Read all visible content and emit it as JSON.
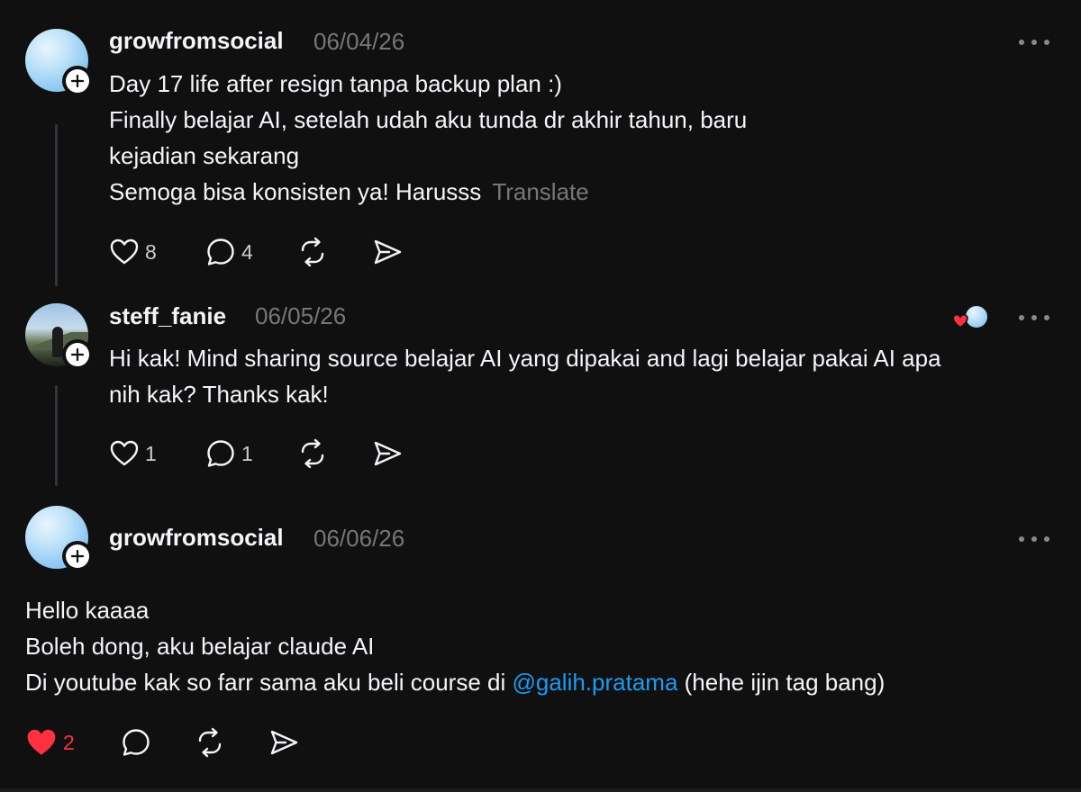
{
  "posts": [
    {
      "username": "growfromsocial",
      "date": "06/04/26",
      "lines": [
        "Day 17 life after resign tanpa backup plan :)",
        "Finally belajar AI, setelah udah aku tunda dr akhir tahun, baru",
        "kejadian sekarang",
        "Semoga bisa konsisten ya! Harusss"
      ],
      "translate_label": "Translate",
      "likes": "8",
      "replies": "4"
    },
    {
      "username": "steff_fanie",
      "date": "06/05/26",
      "lines": [
        "Hi kak! Mind sharing source belajar AI yang dipakai and lagi belajar pakai AI apa",
        "nih kak? Thanks kak!"
      ],
      "likes": "1",
      "replies": "1"
    },
    {
      "username": "growfromsocial",
      "date": "06/06/26",
      "lines": [
        "Hello kaaaa",
        "Boleh dong, aku belajar claude AI"
      ],
      "line3_before": "Di youtube kak so farr sama aku beli course di ",
      "mention": "@galih.pratama",
      "line3_after": " (hehe ijin tag bang)",
      "likes": "2",
      "liked": true
    }
  ],
  "icons": {
    "like": "heart-icon",
    "reply": "comment-icon",
    "repost": "repost-icon",
    "share": "share-icon",
    "more": "more-options-icon",
    "follow": "plus-icon"
  },
  "colors": {
    "background": "#101010",
    "text": "#f3f5f7",
    "muted": "#777777",
    "mention": "#1d9bf0",
    "liked": "#ff3040"
  }
}
